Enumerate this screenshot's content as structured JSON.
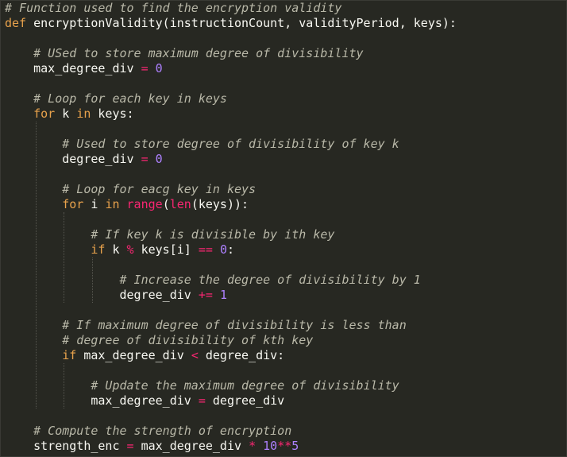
{
  "colors": {
    "background": "#272822",
    "comment": "#b9b8a8",
    "keyword": "#e8a24c",
    "operator": "#f92672",
    "number": "#ae81ff",
    "text": "#f8f8f2"
  },
  "code": {
    "lines": [
      [
        {
          "t": "cm",
          "s": "# Function used to find the encryption validity"
        }
      ],
      [
        {
          "t": "kw",
          "s": "def"
        },
        {
          "t": "tx",
          "s": " encryptionValidity(instructionCount, validityPeriod, keys):"
        }
      ],
      [],
      [
        {
          "t": "tx",
          "s": "    "
        },
        {
          "t": "cm",
          "s": "# USed to store maximum degree of divisibility"
        }
      ],
      [
        {
          "t": "tx",
          "s": "    max_degree_div "
        },
        {
          "t": "op",
          "s": "="
        },
        {
          "t": "tx",
          "s": " "
        },
        {
          "t": "num",
          "s": "0"
        }
      ],
      [],
      [
        {
          "t": "tx",
          "s": "    "
        },
        {
          "t": "cm",
          "s": "# Loop for each key in keys"
        }
      ],
      [
        {
          "t": "tx",
          "s": "    "
        },
        {
          "t": "kw",
          "s": "for"
        },
        {
          "t": "tx",
          "s": " k "
        },
        {
          "t": "kw",
          "s": "in"
        },
        {
          "t": "tx",
          "s": " keys:"
        }
      ],
      [],
      [
        {
          "t": "tx",
          "s": "        "
        },
        {
          "t": "cm",
          "s": "# Used to store degree of divisibility of key k"
        }
      ],
      [
        {
          "t": "tx",
          "s": "        degree_div "
        },
        {
          "t": "op",
          "s": "="
        },
        {
          "t": "tx",
          "s": " "
        },
        {
          "t": "num",
          "s": "0"
        }
      ],
      [],
      [
        {
          "t": "tx",
          "s": "        "
        },
        {
          "t": "cm",
          "s": "# Loop for eacg key in keys"
        }
      ],
      [
        {
          "t": "tx",
          "s": "        "
        },
        {
          "t": "kw",
          "s": "for"
        },
        {
          "t": "tx",
          "s": " i "
        },
        {
          "t": "kw",
          "s": "in"
        },
        {
          "t": "tx",
          "s": " "
        },
        {
          "t": "bi",
          "s": "range"
        },
        {
          "t": "tx",
          "s": "("
        },
        {
          "t": "bi",
          "s": "len"
        },
        {
          "t": "tx",
          "s": "(keys)):"
        }
      ],
      [],
      [
        {
          "t": "tx",
          "s": "            "
        },
        {
          "t": "cm",
          "s": "# If key k is divisible by ith key"
        }
      ],
      [
        {
          "t": "tx",
          "s": "            "
        },
        {
          "t": "kw",
          "s": "if"
        },
        {
          "t": "tx",
          "s": " k "
        },
        {
          "t": "op",
          "s": "%"
        },
        {
          "t": "tx",
          "s": " keys[i] "
        },
        {
          "t": "op",
          "s": "=="
        },
        {
          "t": "tx",
          "s": " "
        },
        {
          "t": "num",
          "s": "0"
        },
        {
          "t": "tx",
          "s": ":"
        }
      ],
      [],
      [
        {
          "t": "tx",
          "s": "                "
        },
        {
          "t": "cm",
          "s": "# Increase the degree of divisibility by 1"
        }
      ],
      [
        {
          "t": "tx",
          "s": "                degree_div "
        },
        {
          "t": "op",
          "s": "+="
        },
        {
          "t": "tx",
          "s": " "
        },
        {
          "t": "num",
          "s": "1"
        }
      ],
      [],
      [
        {
          "t": "tx",
          "s": "        "
        },
        {
          "t": "cm",
          "s": "# If maximum degree of divisibility is less than"
        }
      ],
      [
        {
          "t": "tx",
          "s": "        "
        },
        {
          "t": "cm",
          "s": "# degree of divisibility of kth key"
        }
      ],
      [
        {
          "t": "tx",
          "s": "        "
        },
        {
          "t": "kw",
          "s": "if"
        },
        {
          "t": "tx",
          "s": " max_degree_div "
        },
        {
          "t": "op",
          "s": "<"
        },
        {
          "t": "tx",
          "s": " degree_div:"
        }
      ],
      [],
      [
        {
          "t": "tx",
          "s": "            "
        },
        {
          "t": "cm",
          "s": "# Update the maximum degree of divisibility"
        }
      ],
      [
        {
          "t": "tx",
          "s": "            max_degree_div "
        },
        {
          "t": "op",
          "s": "="
        },
        {
          "t": "tx",
          "s": " degree_div"
        }
      ],
      [],
      [
        {
          "t": "tx",
          "s": "    "
        },
        {
          "t": "cm",
          "s": "# Compute the strength of encryption"
        }
      ],
      [
        {
          "t": "tx",
          "s": "    strength_enc "
        },
        {
          "t": "op",
          "s": "="
        },
        {
          "t": "tx",
          "s": " max_degree_div "
        },
        {
          "t": "op",
          "s": "*"
        },
        {
          "t": "tx",
          "s": " "
        },
        {
          "t": "num",
          "s": "10"
        },
        {
          "t": "op",
          "s": "**"
        },
        {
          "t": "num",
          "s": "5"
        }
      ]
    ]
  }
}
